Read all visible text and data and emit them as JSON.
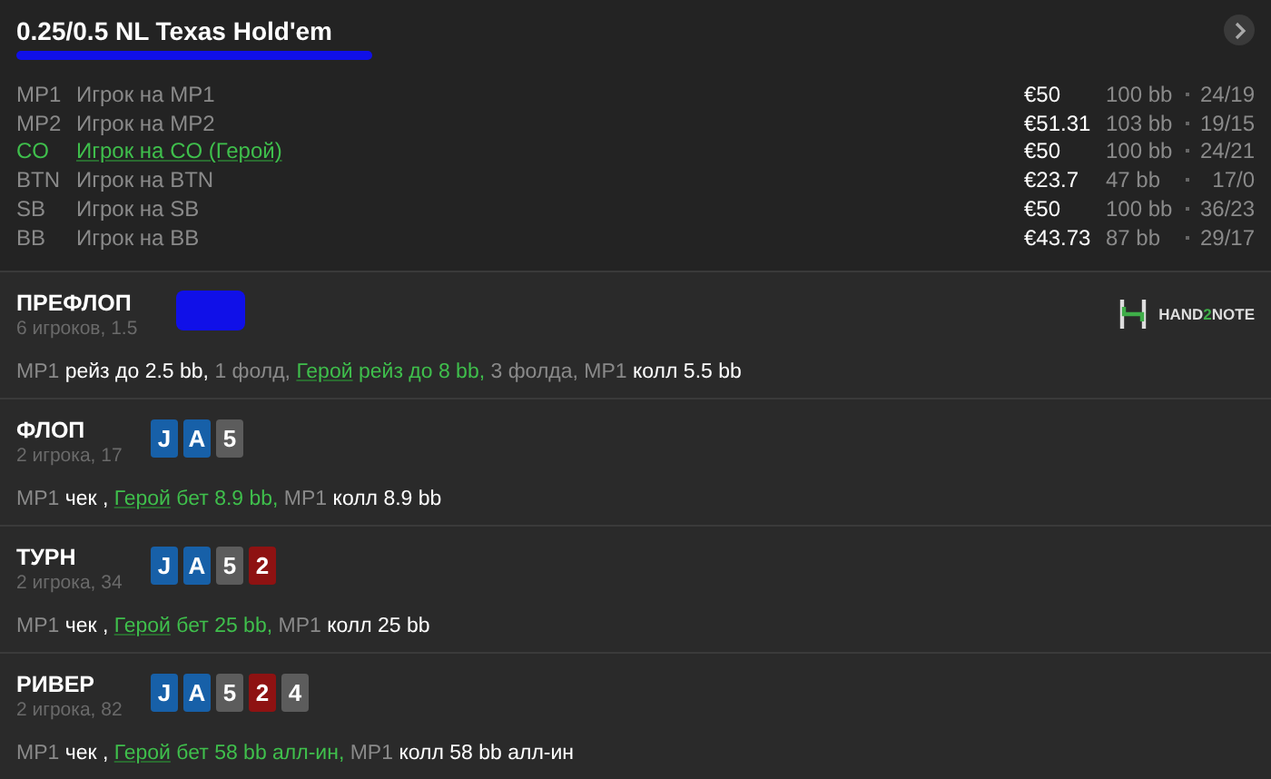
{
  "header": {
    "title": "0.25/0.5 NL Texas Hold'em",
    "subtitle_redacted": true
  },
  "players": [
    {
      "position": "MP1",
      "name": "Игрок на MP1",
      "hero": false,
      "stack": "€50",
      "bb": "100 bb",
      "stats": "24/19"
    },
    {
      "position": "MP2",
      "name": "Игрок на MP2",
      "hero": false,
      "stack": "€51.31",
      "bb": "103 bb",
      "stats": "19/15"
    },
    {
      "position": "CO",
      "name": "Игрок на CO (Герой)",
      "hero": true,
      "stack": "€50",
      "bb": "100 bb",
      "stats": "24/21"
    },
    {
      "position": "BTN",
      "name": "Игрок на BTN",
      "hero": false,
      "stack": "€23.7",
      "bb": "47 bb",
      "stats": "17/0"
    },
    {
      "position": "SB",
      "name": "Игрок на SB",
      "hero": false,
      "stack": "€50",
      "bb": "100 bb",
      "stats": "36/23"
    },
    {
      "position": "BB",
      "name": "Игрок на BB",
      "hero": false,
      "stack": "€43.73",
      "bb": "87 bb",
      "stats": "29/17"
    }
  ],
  "logo": {
    "prefix": "HAND",
    "mid": "2",
    "suffix": "NOTE"
  },
  "streets": [
    {
      "name": "ПРЕФЛОП",
      "info": "6 игроков, 1.5",
      "redacted": true,
      "actions": [
        {
          "kind": "muted",
          "text": "MP1 "
        },
        {
          "kind": "bright",
          "text": "рейз до 2.5 bb,"
        },
        {
          "kind": "muted",
          "text": " 1 фолд, "
        },
        {
          "kind": "hero-name",
          "text": "Герой"
        },
        {
          "kind": "hero",
          "text": " рейз до 8 bb,"
        },
        {
          "kind": "muted",
          "text": " 3 фолда, MP1 "
        },
        {
          "kind": "bright",
          "text": "колл 5.5 bb"
        }
      ]
    },
    {
      "name": "ФЛОП",
      "info": "2 игрока, 17",
      "cards": [
        {
          "rank": "J",
          "color": "#1760a8"
        },
        {
          "rank": "A",
          "color": "#1760a8"
        },
        {
          "rank": "5",
          "color": "#5c5c5c"
        }
      ],
      "actions": [
        {
          "kind": "muted",
          "text": "MP1 "
        },
        {
          "kind": "bright",
          "text": "чек , "
        },
        {
          "kind": "hero-name",
          "text": "Герой"
        },
        {
          "kind": "hero",
          "text": " бет 8.9 bb,"
        },
        {
          "kind": "muted",
          "text": " MP1 "
        },
        {
          "kind": "bright",
          "text": "колл 8.9 bb"
        }
      ]
    },
    {
      "name": "ТУРН",
      "info": "2 игрока, 34",
      "cards": [
        {
          "rank": "J",
          "color": "#1760a8"
        },
        {
          "rank": "A",
          "color": "#1760a8"
        },
        {
          "rank": "5",
          "color": "#5c5c5c"
        },
        {
          "rank": "2",
          "color": "#8e1212"
        }
      ],
      "actions": [
        {
          "kind": "muted",
          "text": "MP1 "
        },
        {
          "kind": "bright",
          "text": "чек , "
        },
        {
          "kind": "hero-name",
          "text": "Герой"
        },
        {
          "kind": "hero",
          "text": " бет 25 bb,"
        },
        {
          "kind": "muted",
          "text": " MP1 "
        },
        {
          "kind": "bright",
          "text": "колл 25 bb"
        }
      ]
    },
    {
      "name": "РИВЕР",
      "info": "2 игрока, 82",
      "cards": [
        {
          "rank": "J",
          "color": "#1760a8"
        },
        {
          "rank": "A",
          "color": "#1760a8"
        },
        {
          "rank": "5",
          "color": "#5c5c5c"
        },
        {
          "rank": "2",
          "color": "#8e1212"
        },
        {
          "rank": "4",
          "color": "#5c5c5c"
        }
      ],
      "actions": [
        {
          "kind": "muted",
          "text": "MP1 "
        },
        {
          "kind": "bright",
          "text": "чек , "
        },
        {
          "kind": "hero-name",
          "text": "Герой"
        },
        {
          "kind": "hero",
          "text": " бет 58 bb алл-ин,"
        },
        {
          "kind": "muted",
          "text": " MP1 "
        },
        {
          "kind": "bright",
          "text": "колл 58 bb алл-ин"
        }
      ]
    }
  ]
}
